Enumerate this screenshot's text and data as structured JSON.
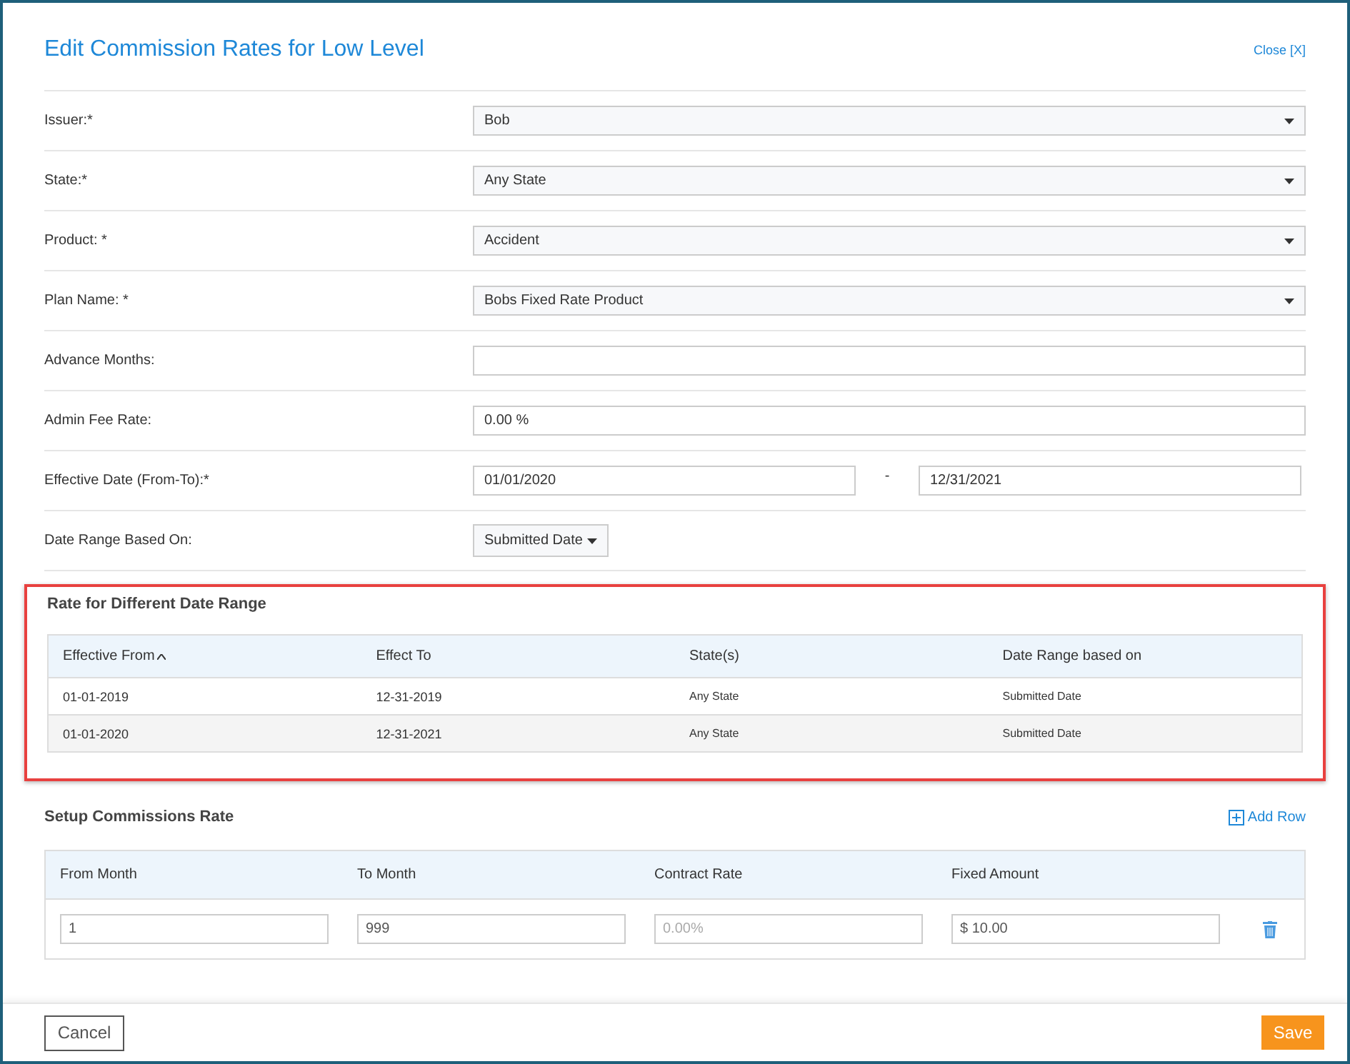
{
  "dialog": {
    "title": "Edit Commission Rates for Low Level",
    "close_link": "Close [X]"
  },
  "fields": [
    {
      "label": "Issuer:*",
      "kind": "select",
      "value": "Bob"
    },
    {
      "label": "State:*",
      "kind": "select",
      "value": "Any State"
    },
    {
      "label": "Product: *",
      "kind": "select",
      "value": "Accident"
    },
    {
      "label": "Plan Name: *",
      "kind": "select",
      "value": "Bobs Fixed Rate Product"
    },
    {
      "label": "Advance Months:",
      "kind": "input"
    },
    {
      "label": "Admin Fee Rate:",
      "kind": "input",
      "value": "0.00 %"
    },
    {
      "label": "Effective Date (From-To):*",
      "kind": "daterange",
      "from": "01/01/2020",
      "separator": "-",
      "to": "12/31/2021"
    },
    {
      "label": "Date Range Based On:",
      "kind": "dropdown",
      "value": "Submitted Date"
    }
  ],
  "date_ranges": {
    "title": "Rate for Different Date Range",
    "highlighted": true,
    "columns": [
      {
        "label": "Effective From",
        "sorted": true
      },
      {
        "label": "Effect To",
        "sorted": false
      },
      {
        "label": "State(s)",
        "sorted": false
      },
      {
        "label": "Date Range based on",
        "sorted": false
      }
    ],
    "rows": [
      [
        "01-01-2019",
        "12-31-2019",
        "Any State",
        "Submitted Date"
      ],
      [
        "01-01-2020",
        "12-31-2021",
        "Any State",
        "Submitted Date"
      ]
    ]
  },
  "commissions": {
    "title": "Setup Commissions Rate",
    "add_link": "Add Row",
    "columns": [
      "From Month",
      "To Month",
      "Contract Rate",
      "Fixed Amount"
    ],
    "rows": [
      [
        {
          "value": "1"
        },
        {
          "value": "999"
        },
        {
          "placeholder": "0.00%"
        },
        {
          "value": "$ 10.00"
        }
      ]
    ]
  },
  "footer": {
    "cancel": "Cancel",
    "save": "Save"
  }
}
